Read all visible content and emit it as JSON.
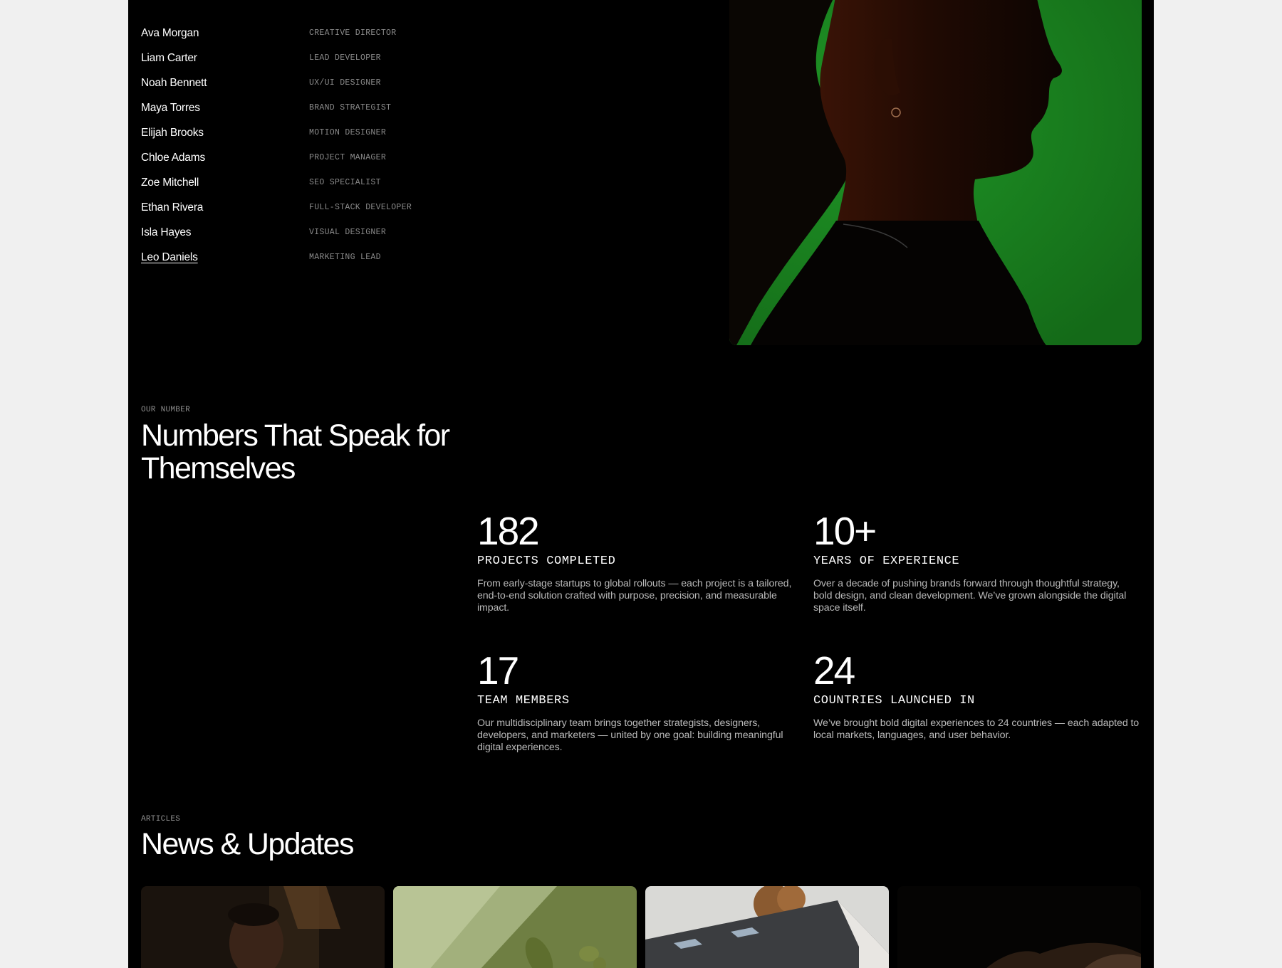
{
  "team": {
    "members": [
      {
        "name": "Ava Morgan",
        "role": "CREATIVE DIRECTOR"
      },
      {
        "name": "Liam Carter",
        "role": "LEAD DEVELOPER"
      },
      {
        "name": "Noah Bennett",
        "role": "UX/UI DESIGNER"
      },
      {
        "name": "Maya Torres",
        "role": "BRAND STRATEGIST"
      },
      {
        "name": "Elijah Brooks",
        "role": "MOTION DESIGNER"
      },
      {
        "name": "Chloe Adams",
        "role": "PROJECT MANAGER"
      },
      {
        "name": "Zoe Mitchell",
        "role": "SEO SPECIALIST"
      },
      {
        "name": "Ethan Rivera",
        "role": "FULL-STACK DEVELOPER"
      },
      {
        "name": "Isla Hayes",
        "role": "VISUAL DESIGNER"
      },
      {
        "name": "Leo Daniels",
        "role": "MARKETING LEAD"
      }
    ],
    "active_member": "Leo Daniels"
  },
  "numbers": {
    "eyebrow": "OUR NUMBER",
    "title_line1": "Numbers That Speak for",
    "title_line2": "Themselves",
    "stats": [
      {
        "value": "182",
        "label": "PROJECTS COMPLETED",
        "desc": "From early-stage startups to global rollouts — each project is a tailored, end-to-end solution crafted with purpose, precision, and measurable impact."
      },
      {
        "value": "10+",
        "label": "YEARS OF EXPERIENCE",
        "desc": "Over a decade of pushing brands forward through thoughtful strategy, bold design, and clean development. We’ve grown alongside the digital space itself."
      },
      {
        "value": "17",
        "label": "TEAM MEMBERS",
        "desc": "Our multidisciplinary team brings together strategists, designers, developers, and marketers — united by one goal: building meaningful digital experiences."
      },
      {
        "value": "24",
        "label": "COUNTRIES LAUNCHED IN",
        "desc": "We’ve brought bold digital experiences to 24 countries — each adapted to local markets, languages, and user behavior."
      }
    ]
  },
  "articles": {
    "eyebrow": "ARTICLES",
    "title": "News & Updates"
  },
  "colors": {
    "page_bg": "#000000",
    "outer_bg": "#f0f0f0",
    "portrait_green": "#1c8a22",
    "muted_text": "#8a8a8a"
  }
}
